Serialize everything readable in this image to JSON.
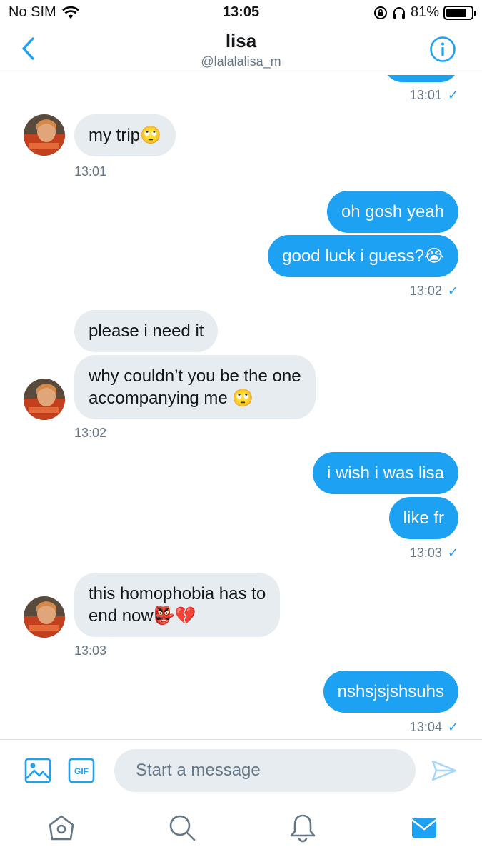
{
  "status_bar": {
    "carrier": "No SIM",
    "time": "13:05",
    "battery": "81%",
    "battery_level": 0.81
  },
  "header": {
    "name": "lisa",
    "handle": "@lalalalisa_m"
  },
  "messages": [
    {
      "dir": "in",
      "text": "my trip🙄"
    },
    {
      "dir": "out",
      "text": "oh gosh yeah"
    },
    {
      "dir": "out",
      "text": "good luck i guess?😭"
    },
    {
      "dir": "in",
      "text": "please i need it"
    },
    {
      "dir": "in",
      "text": "why couldn’t you be the one\naccompanying me 🙄"
    },
    {
      "dir": "out",
      "text": "i wish i was lisa"
    },
    {
      "dir": "out",
      "text": "like fr"
    },
    {
      "dir": "in",
      "text": "this homophobia has to\nend now👺💔"
    },
    {
      "dir": "out",
      "text": "nshsjsjshsuhs"
    }
  ],
  "timestamps": {
    "t0": "13:01",
    "t1": "13:01",
    "t2": "13:02",
    "t3": "13:02",
    "t4": "13:03",
    "t5": "13:03",
    "t6": "13:04"
  },
  "read_mark": "✓",
  "composer": {
    "placeholder": "Start a message",
    "gif_label": "GIF"
  },
  "colors": {
    "accent": "#1da1f2",
    "incoming_bubble": "#e6ecf0",
    "secondary_text": "#657786"
  },
  "icons": {
    "back": "chevron-left-icon",
    "info": "info-icon",
    "image": "image-icon",
    "gif": "gif-icon",
    "send": "send-icon",
    "home": "home-icon",
    "search": "search-icon",
    "notifications": "bell-icon",
    "messages": "mail-icon"
  }
}
